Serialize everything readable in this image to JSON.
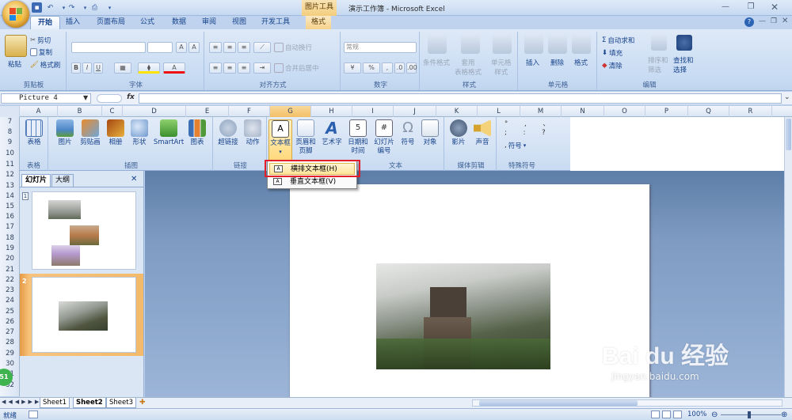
{
  "window": {
    "title": "演示工作簿 - Microsoft Excel",
    "context_tab": "图片工具"
  },
  "tabs": [
    "开始",
    "插入",
    "页面布局",
    "公式",
    "数据",
    "审阅",
    "视图",
    "开发工具",
    "格式"
  ],
  "ribbon": {
    "clipboard": {
      "label": "剪贴板",
      "paste": "粘贴",
      "cut": "剪切",
      "copy": "复制",
      "format_painter": "格式刷"
    },
    "font": {
      "label": "字体"
    },
    "align": {
      "label": "对齐方式",
      "wrap": "自动换行",
      "merge": "合并后居中"
    },
    "number": {
      "label": "数字",
      "format": "常规"
    },
    "styles": {
      "label": "样式",
      "cond": "条件格式",
      "table": "套用\n表格格式",
      "cell": "单元格\n样式"
    },
    "cells": {
      "label": "单元格",
      "insert": "插入",
      "delete": "删除",
      "format": "格式"
    },
    "edit": {
      "label": "编辑",
      "autosum": "自动求和",
      "fill": "填充",
      "clear": "清除",
      "sort": "排序和\n筛选",
      "find": "查找和\n选择"
    }
  },
  "formula": {
    "namebox": "Picture 4",
    "fx": "fx"
  },
  "columns": [
    "A",
    "B",
    "C",
    "D",
    "E",
    "F",
    "G",
    "H",
    "I",
    "J",
    "K",
    "L",
    "M",
    "N",
    "O",
    "P",
    "Q",
    "R"
  ],
  "rows": [
    "7",
    "8",
    "9",
    "10",
    "11",
    "12",
    "13",
    "14",
    "15",
    "16",
    "17",
    "18",
    "19",
    "20",
    "21",
    "22",
    "23",
    "24",
    "25",
    "26",
    "27",
    "28",
    "29",
    "30",
    "31",
    "32"
  ],
  "ppt_ribbon": {
    "groups": {
      "tables": "表格",
      "illustrations": "插图",
      "links": "链接",
      "text": "文本",
      "media": "媒体剪辑",
      "symbols": "特殊符号"
    },
    "items": {
      "table": "表格",
      "picture": "图片",
      "clipart": "剪贴画",
      "album": "相册",
      "shapes": "形状",
      "smartart": "SmartArt",
      "chart": "图表",
      "hyperlink": "超链接",
      "action": "动作",
      "textbox": "文本框",
      "header": "页眉和\n页脚",
      "wordart": "艺术字",
      "datetime": "日期和\n时间",
      "slidenum": "幻灯片\n编号",
      "symbol": "符号",
      "object": "对象",
      "movie": "影片",
      "sound": "声音",
      "special": "符号"
    }
  },
  "dropdown": {
    "horizontal": "横排文本框(H)",
    "vertical": "垂直文本框(V)"
  },
  "panel": {
    "slides_tab": "幻灯片",
    "outline_tab": "大纲",
    "close": "✕",
    "slide1_num": "1",
    "slide2_num": "2"
  },
  "sheets": [
    "Sheet1",
    "Sheet2",
    "Sheet3"
  ],
  "status": {
    "ready": "就绪",
    "zoom": "100%"
  },
  "watermark": {
    "brand": "Bai du 经验",
    "url": "jingyan.baidu.com"
  },
  "badge": "51",
  "colors": {
    "accent": "#15428b",
    "ribbon": "#c7dbf3",
    "highlight": "#ffe59c",
    "red_box": "#e31f29"
  }
}
